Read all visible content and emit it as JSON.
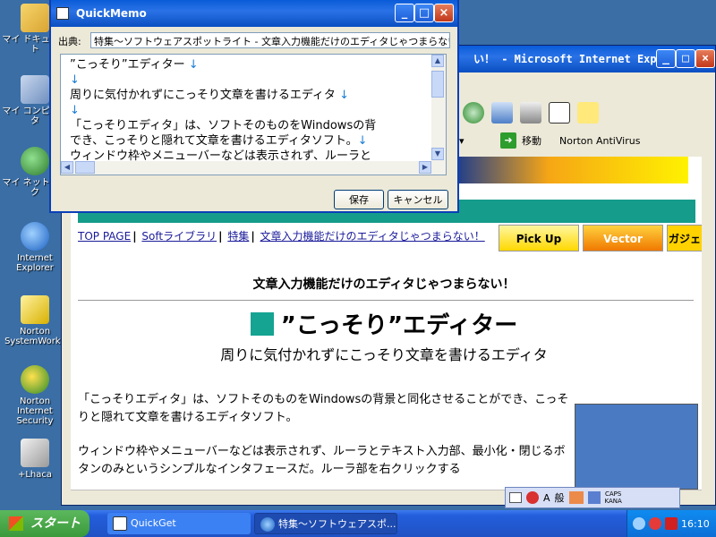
{
  "desktop": {
    "icons": [
      {
        "label": "マイ ドキュメント"
      },
      {
        "label": "マイ コンピュータ"
      },
      {
        "label": "マイ ネットワーク"
      },
      {
        "label": "Internet Explorer"
      },
      {
        "label": "Norton SystemWorks"
      },
      {
        "label": "Norton Internet Security"
      },
      {
        "label": "+Lhaca"
      }
    ]
  },
  "ie": {
    "title": "い！ - Microsoft Internet Expl...",
    "go_label": "移動",
    "norton_label": "Norton AntiVirus",
    "page": {
      "breadcrumbs": [
        "TOP PAGE",
        "Softライブラリ",
        "特集",
        "文章入力機能だけのエディタじゃつまらない！"
      ],
      "ads": [
        "Pick Up",
        "Vector",
        "ガジェ"
      ],
      "heading": "文章入力機能だけのエディタじゃつまらない！",
      "title": "”こっそり”エディター",
      "subtitle": "周りに気付かれずにこっそり文章を書けるエディタ",
      "para1": "「こっそりエディタ」は、ソフトそのものをWindowsの背景と同化させることができ、こっそりと隠れて文章を書けるエディタソフト。",
      "para2": "ウィンドウ枠やメニューバーなどは表示されず、ルーラとテキスト入力部、最小化・閉じるボタンのみというシンプルなインタフェースだ。ルーラ部を右クリックする"
    }
  },
  "quickmemo": {
    "title": "QuickMemo",
    "source_label": "出典:",
    "source_value": "特集～ソフトウェアスポットライト - 文章入力機能だけのエディタじゃつまらない",
    "lines": [
      "”こっそり”エディター ",
      " ",
      "周りに気付かれずにこっそり文章を書けるエディタ ",
      " ",
      "「こっそりエディタ」は、ソフトそのものをWindowsの背",
      "でき、こっそりと隠れて文章を書けるエディタソフト。",
      "ウィンドウ枠やメニューバーなどは表示されず、ルーラと"
    ],
    "arrow": "↓",
    "save_label": "保存",
    "cancel_label": "キャンセル"
  },
  "ime": {
    "mode": "A",
    "mode2": "般",
    "caps": "CAPS",
    "kana": "KANA"
  },
  "taskbar": {
    "start_label": "スタート",
    "tasks": [
      "QuickGet",
      "特集～ソフトウェアスポ..."
    ],
    "clock": "16:10"
  },
  "colors": {
    "xp_blue": "#245edb",
    "desktop": "#3a6ea5",
    "teal": "#169c8b"
  }
}
